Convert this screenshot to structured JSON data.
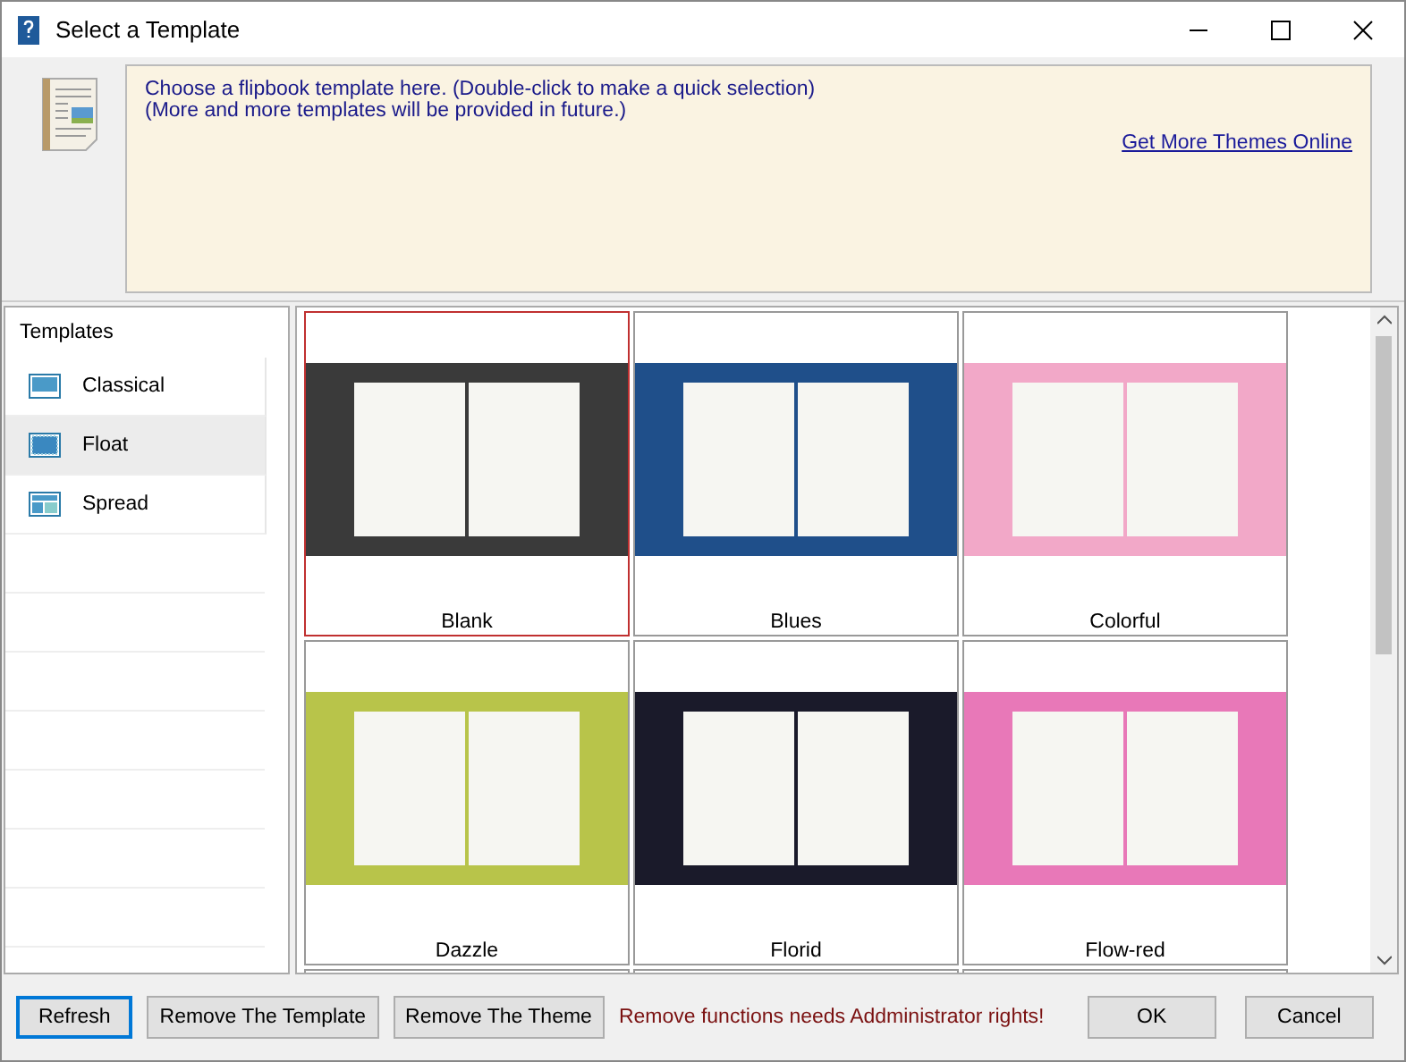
{
  "window": {
    "title": "Select a Template"
  },
  "info": {
    "lines": [
      "Choose a flipbook template here. (Double-click to make a quick selection)",
      "(More and more templates will be provided in future.)"
    ],
    "link": "Get More Themes Online"
  },
  "sidebar": {
    "heading": "Templates",
    "items": [
      {
        "label": "Classical",
        "kind": "classical",
        "selected": false
      },
      {
        "label": "Float",
        "kind": "float",
        "selected": true
      },
      {
        "label": "Spread",
        "kind": "spread",
        "selected": false
      }
    ]
  },
  "templates": [
    {
      "name": "Blank",
      "color": "#3a3a3a",
      "selected": true
    },
    {
      "name": "Blues",
      "color": "#1f4f8a",
      "selected": false
    },
    {
      "name": "Colorful",
      "color": "#f2a8c8",
      "selected": false
    },
    {
      "name": "Dazzle",
      "color": "#b8c44a",
      "selected": false
    },
    {
      "name": "Florid",
      "color": "#1a1a2a",
      "selected": false
    },
    {
      "name": "Flow-red",
      "color": "#e878b8",
      "selected": false
    }
  ],
  "buttons": {
    "refresh": "Refresh",
    "remove_template": "Remove The Template",
    "remove_theme": "Remove The Theme",
    "ok": "OK",
    "cancel": "Cancel"
  },
  "warning": "Remove functions needs Addministrator rights!"
}
